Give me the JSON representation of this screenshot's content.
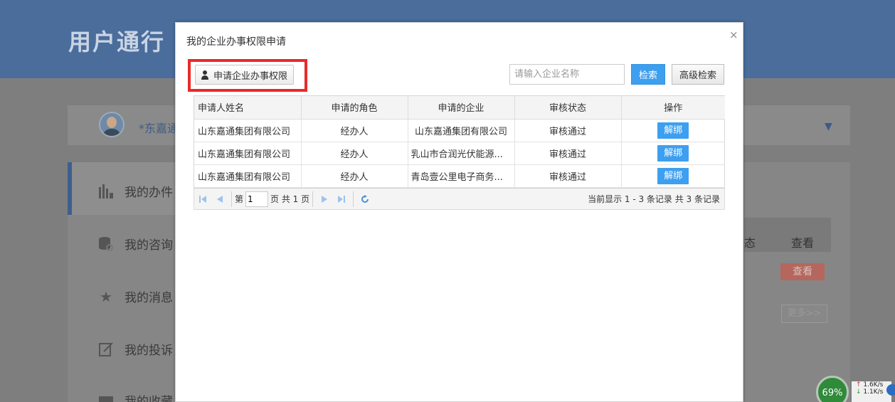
{
  "background": {
    "header_title": "用户通行",
    "username": "*东嘉通",
    "sidebar_items": [
      {
        "label": "我的办件",
        "icon": "bar-chart-icon"
      },
      {
        "label": "我的咨询",
        "icon": "database-search-icon"
      },
      {
        "label": "我的消息",
        "icon": "star-icon"
      },
      {
        "label": "我的投诉",
        "icon": "edit-note-icon"
      },
      {
        "label": "我的收藏",
        "icon": "folder-icon"
      }
    ],
    "table_header_partial": "态",
    "table_header_view": "查看",
    "view_button": "查看",
    "more_button": "更多>>"
  },
  "modal": {
    "title": "我的企业办事权限申请",
    "close_symbol": "×",
    "apply_button": "申请企业办事权限",
    "search_placeholder": "请输入企业名称",
    "search_button": "检索",
    "advanced_search_button": "高级检索",
    "columns": [
      "申请人姓名",
      "申请的角色",
      "申请的企业",
      "审核状态",
      "操作"
    ],
    "rows": [
      {
        "applicant": "山东嘉通集团有限公司",
        "role": "经办人",
        "enterprise": "山东嘉通集团有限公司",
        "status": "审核通过",
        "action": "解绑"
      },
      {
        "applicant": "山东嘉通集团有限公司",
        "role": "经办人",
        "enterprise": "乳山市合润光伏能源...",
        "status": "审核通过",
        "action": "解绑"
      },
      {
        "applicant": "山东嘉通集团有限公司",
        "role": "经办人",
        "enterprise": "青岛壹公里电子商务...",
        "status": "审核通过",
        "action": "解绑"
      }
    ],
    "pager": {
      "page_prefix": "第",
      "page_value": "1",
      "page_suffix": "页 共 1 页",
      "info": "当前显示 1 - 3 条记录 共 3 条记录"
    }
  },
  "tray": {
    "percent": "69%",
    "upload_rate": "1.6K/s",
    "download_rate": "1.1K/s"
  },
  "colors": {
    "primary_blue": "#3d9ff0",
    "highlight_red": "#e82a2a",
    "header_blue": "#4a6d9c"
  }
}
